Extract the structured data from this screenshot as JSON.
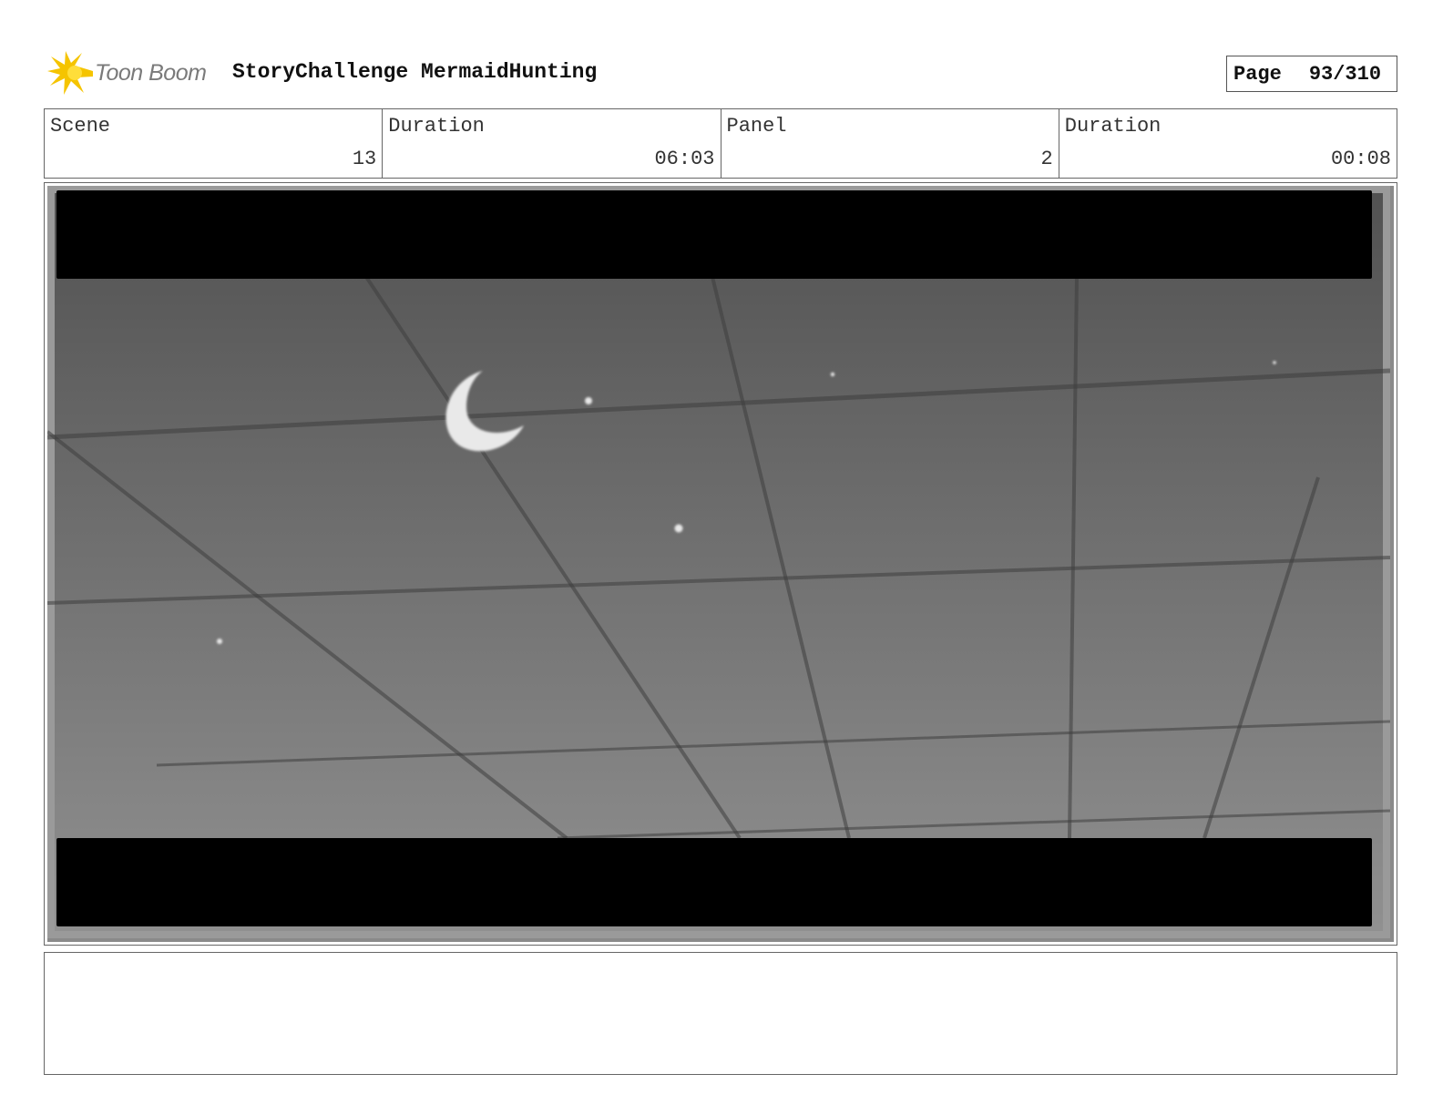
{
  "header": {
    "logo_text": "Toon Boom",
    "title": "StoryChallenge MermaidHunting",
    "page_label": "Page",
    "page_value": "93/310"
  },
  "info": {
    "scene_label": "Scene",
    "scene_value": "13",
    "scene_duration_label": "Duration",
    "scene_duration_value": "06:03",
    "panel_label": "Panel",
    "panel_value": "2",
    "panel_duration_label": "Duration",
    "panel_duration_value": "00:08"
  },
  "notes": {
    "text": ""
  },
  "colors": {
    "logo_burst": "#f5c400",
    "letterbox": "#000000",
    "sky_top": "#555555",
    "sky_bottom": "#8f8f8f"
  }
}
